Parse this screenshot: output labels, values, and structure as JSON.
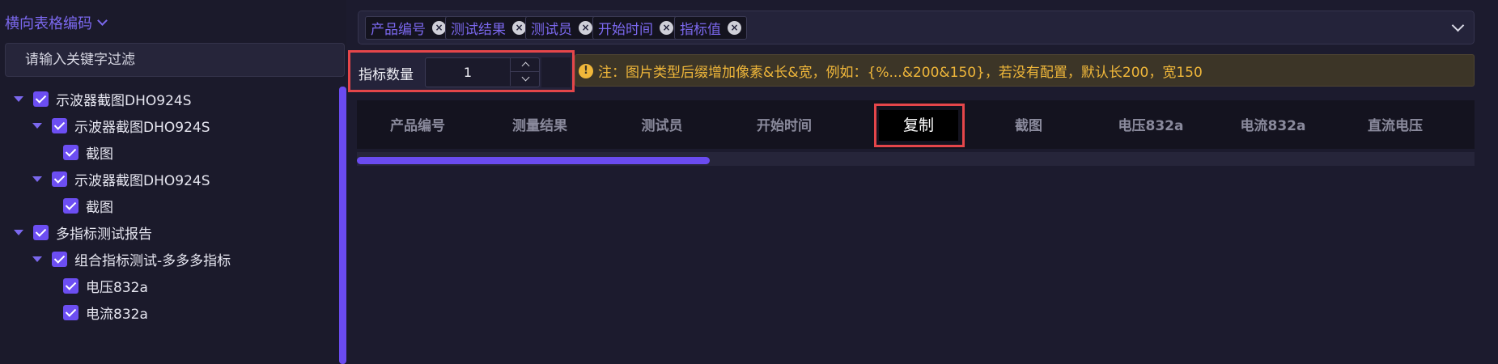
{
  "left_panel": {
    "mode_label": "横向表格编码",
    "filter_placeholder": "请输入关键字过滤",
    "tree": [
      {
        "label": "示波器截图DHO924S"
      },
      {
        "label": "示波器截图DHO924S"
      },
      {
        "label": "截图"
      },
      {
        "label": "示波器截图DHO924S"
      },
      {
        "label": "截图"
      },
      {
        "label": "多指标测试报告"
      },
      {
        "label": "组合指标测试-多多多指标"
      },
      {
        "label": "电压832a"
      },
      {
        "label": "电流832a"
      }
    ]
  },
  "tags": [
    "产品编号",
    "测试结果",
    "测试员",
    "开始时间",
    "指标值"
  ],
  "indicator": {
    "label": "指标数量",
    "value": "1"
  },
  "notice": {
    "text": "注：图片类型后缀增加像素&长&宽，例如：{%...&200&150}，若没有配置，默认长200，宽150"
  },
  "table": {
    "columns": [
      "产品编号",
      "测量结果",
      "测试员",
      "开始时间",
      "截图",
      "截图",
      "电压832a",
      "电流832a",
      "直流电压"
    ]
  },
  "copy_popup": {
    "label": "复制"
  },
  "scrollbar": {
    "horizontal_position_fraction": 0.27
  },
  "colors": {
    "accent": "#6a4bf0",
    "highlight_border": "#e5464a",
    "warning": "#f0b73a"
  }
}
